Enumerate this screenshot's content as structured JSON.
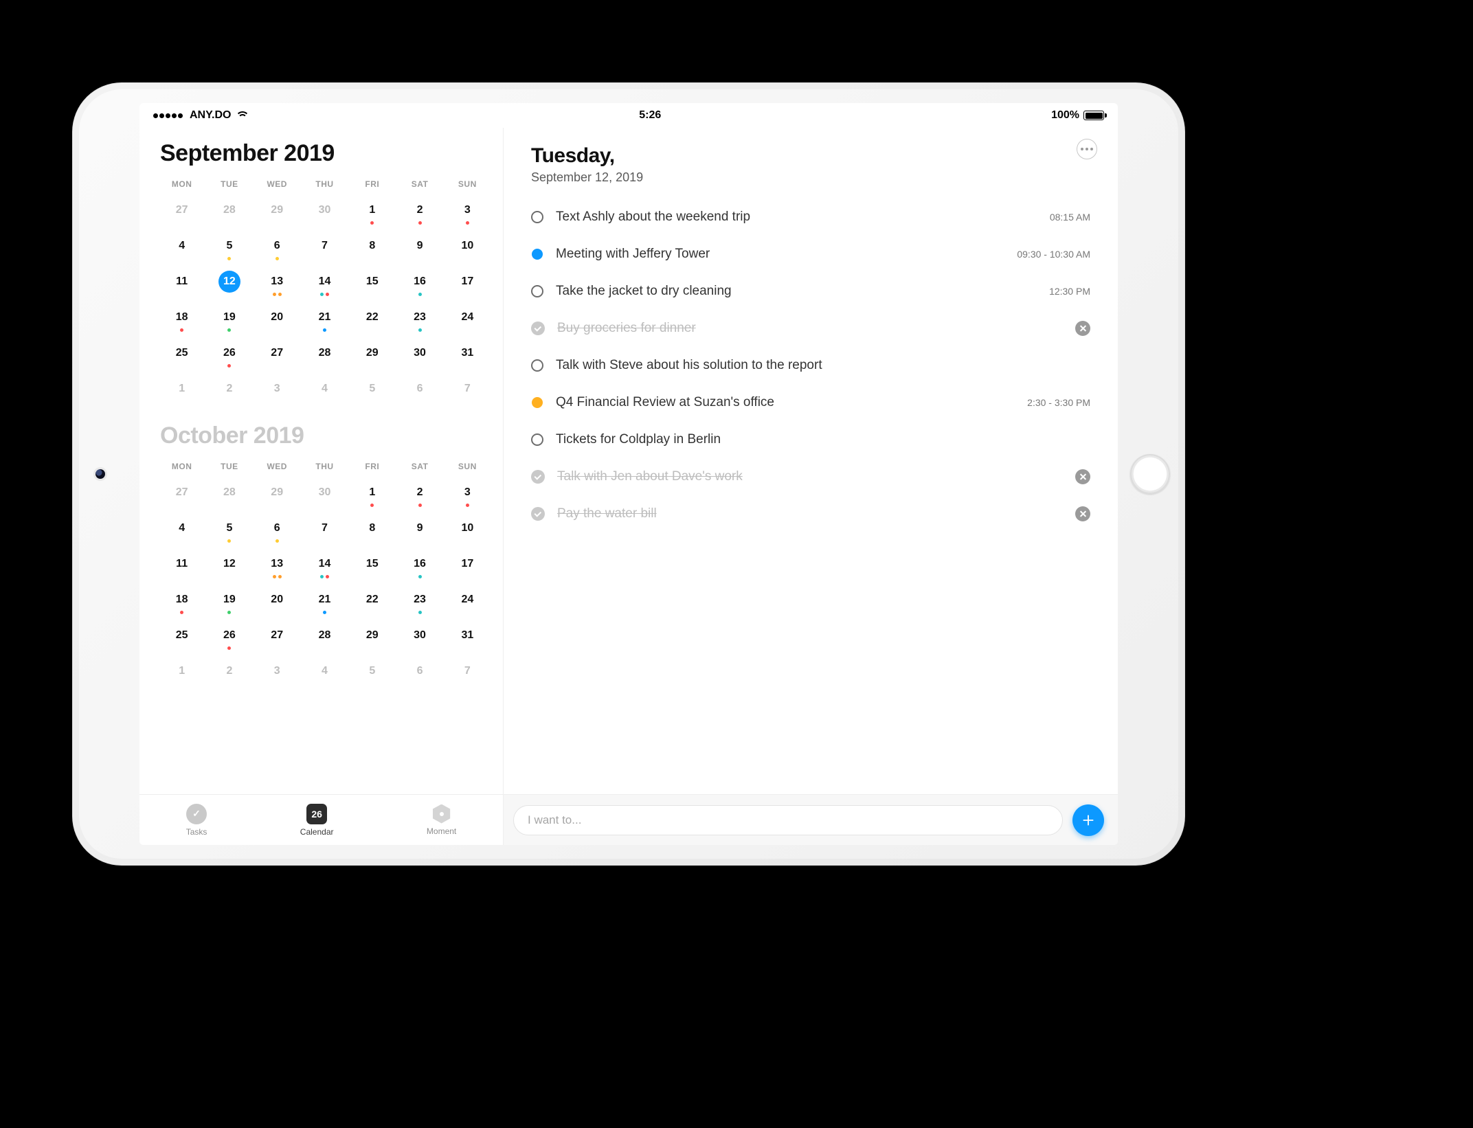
{
  "statusbar": {
    "carrier": "ANY.DO",
    "time": "5:26",
    "battery_pct": "100%"
  },
  "calendar": {
    "dow": [
      "MON",
      "TUE",
      "WED",
      "THU",
      "FRI",
      "SAT",
      "SUN"
    ],
    "months": [
      {
        "title": "September 2019",
        "dim": false,
        "weeks": [
          [
            {
              "n": "27",
              "other": true
            },
            {
              "n": "28",
              "other": true
            },
            {
              "n": "29",
              "other": true
            },
            {
              "n": "30",
              "other": true
            },
            {
              "n": "1",
              "dots": [
                "red"
              ]
            },
            {
              "n": "2",
              "dots": [
                "red"
              ]
            },
            {
              "n": "3",
              "dots": [
                "red"
              ]
            }
          ],
          [
            {
              "n": "4"
            },
            {
              "n": "5",
              "dots": [
                "yellow"
              ]
            },
            {
              "n": "6",
              "dots": [
                "yellow"
              ]
            },
            {
              "n": "7"
            },
            {
              "n": "8"
            },
            {
              "n": "9"
            },
            {
              "n": "10"
            }
          ],
          [
            {
              "n": "11"
            },
            {
              "n": "12",
              "selected": true
            },
            {
              "n": "13",
              "dots": [
                "orange",
                "orange"
              ]
            },
            {
              "n": "14",
              "dots": [
                "teal",
                "red"
              ]
            },
            {
              "n": "15"
            },
            {
              "n": "16",
              "dots": [
                "teal"
              ]
            },
            {
              "n": "17"
            }
          ],
          [
            {
              "n": "18",
              "dots": [
                "red"
              ]
            },
            {
              "n": "19",
              "dots": [
                "green"
              ]
            },
            {
              "n": "20"
            },
            {
              "n": "21",
              "dots": [
                "blue"
              ]
            },
            {
              "n": "22"
            },
            {
              "n": "23",
              "dots": [
                "teal"
              ]
            },
            {
              "n": "24"
            }
          ],
          [
            {
              "n": "25"
            },
            {
              "n": "26",
              "dots": [
                "red"
              ]
            },
            {
              "n": "27"
            },
            {
              "n": "28"
            },
            {
              "n": "29"
            },
            {
              "n": "30"
            },
            {
              "n": "31"
            }
          ],
          [
            {
              "n": "1",
              "other": true
            },
            {
              "n": "2",
              "other": true
            },
            {
              "n": "3",
              "other": true
            },
            {
              "n": "4",
              "other": true
            },
            {
              "n": "5",
              "other": true
            },
            {
              "n": "6",
              "other": true
            },
            {
              "n": "7",
              "other": true
            }
          ]
        ]
      },
      {
        "title": "October 2019",
        "dim": true,
        "weeks": [
          [
            {
              "n": "27",
              "other": true
            },
            {
              "n": "28",
              "other": true
            },
            {
              "n": "29",
              "other": true
            },
            {
              "n": "30",
              "other": true
            },
            {
              "n": "1",
              "dots": [
                "red"
              ]
            },
            {
              "n": "2",
              "dots": [
                "red"
              ]
            },
            {
              "n": "3",
              "dots": [
                "red"
              ]
            }
          ],
          [
            {
              "n": "4"
            },
            {
              "n": "5",
              "dots": [
                "yellow"
              ]
            },
            {
              "n": "6",
              "dots": [
                "yellow"
              ]
            },
            {
              "n": "7"
            },
            {
              "n": "8"
            },
            {
              "n": "9"
            },
            {
              "n": "10"
            }
          ],
          [
            {
              "n": "11"
            },
            {
              "n": "12"
            },
            {
              "n": "13",
              "dots": [
                "orange",
                "orange"
              ]
            },
            {
              "n": "14",
              "dots": [
                "teal",
                "red"
              ]
            },
            {
              "n": "15"
            },
            {
              "n": "16",
              "dots": [
                "teal"
              ]
            },
            {
              "n": "17"
            }
          ],
          [
            {
              "n": "18",
              "dots": [
                "red"
              ]
            },
            {
              "n": "19",
              "dots": [
                "green"
              ]
            },
            {
              "n": "20"
            },
            {
              "n": "21",
              "dots": [
                "blue"
              ]
            },
            {
              "n": "22"
            },
            {
              "n": "23",
              "dots": [
                "teal"
              ]
            },
            {
              "n": "24"
            }
          ],
          [
            {
              "n": "25"
            },
            {
              "n": "26",
              "dots": [
                "red"
              ]
            },
            {
              "n": "27"
            },
            {
              "n": "28"
            },
            {
              "n": "29"
            },
            {
              "n": "30"
            },
            {
              "n": "31"
            }
          ],
          [
            {
              "n": "1",
              "other": true
            },
            {
              "n": "2",
              "other": true
            },
            {
              "n": "3",
              "other": true
            },
            {
              "n": "4",
              "other": true
            },
            {
              "n": "5",
              "other": true
            },
            {
              "n": "6",
              "other": true
            },
            {
              "n": "7",
              "other": true
            }
          ]
        ]
      }
    ]
  },
  "tabs": {
    "tasks": {
      "label": "Tasks"
    },
    "calendar": {
      "label": "Calendar",
      "badge": "26"
    },
    "moment": {
      "label": "Moment"
    }
  },
  "day": {
    "title": "Tuesday,",
    "subtitle": "September 12, 2019"
  },
  "tasks": [
    {
      "kind": "todo",
      "text": "Text Ashly about the weekend trip",
      "time": "08:15 AM"
    },
    {
      "kind": "event",
      "color": "#0d99ff",
      "text": "Meeting with Jeffery Tower",
      "time": "09:30 - 10:30 AM"
    },
    {
      "kind": "todo",
      "text": "Take the jacket to dry cleaning",
      "time": "12:30 PM"
    },
    {
      "kind": "done",
      "text": "Buy groceries for dinner"
    },
    {
      "kind": "todo",
      "text": "Talk with Steve about his solution to the report"
    },
    {
      "kind": "event",
      "color": "#ffb020",
      "text": "Q4 Financial Review at Suzan's office",
      "time": "2:30 - 3:30 PM"
    },
    {
      "kind": "todo",
      "text": "Tickets for Coldplay in Berlin"
    },
    {
      "kind": "done",
      "text": "Talk with Jen about Dave's work"
    },
    {
      "kind": "done",
      "text": "Pay the water bill"
    }
  ],
  "input": {
    "placeholder": "I want to..."
  },
  "colors": {
    "accent": "#0d99ff"
  }
}
